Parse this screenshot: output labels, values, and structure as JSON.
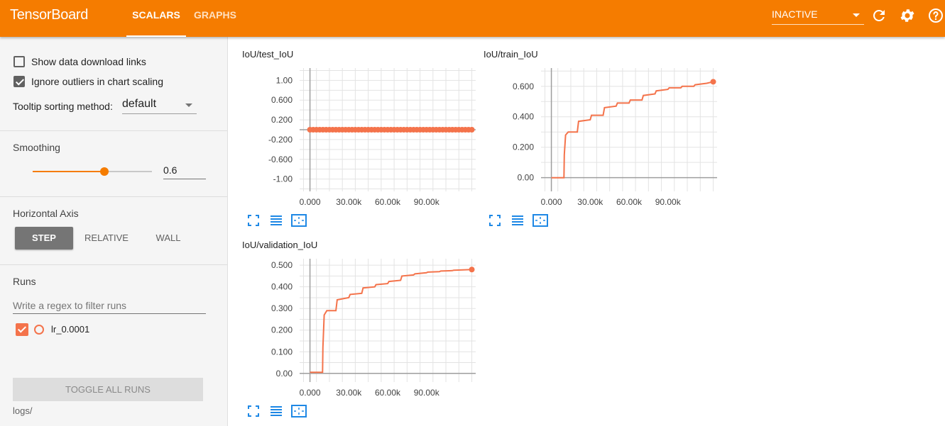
{
  "app": {
    "title": "TensorBoard"
  },
  "tabs": [
    {
      "label": "SCALARS",
      "active": true
    },
    {
      "label": "GRAPHS",
      "active": false
    }
  ],
  "status_select": {
    "value": "INACTIVE"
  },
  "icons": {
    "refresh": "refresh-icon",
    "settings": "gear-icon",
    "help": "help-icon",
    "fullscreen": "fullscreen-icon",
    "data": "list-icon",
    "fit": "fit-domain-icon"
  },
  "colors": {
    "accent": "#f57c00",
    "series": "#f4734b",
    "sidebar_bg": "#f5f5f5"
  },
  "options": {
    "show_download": {
      "label": "Show data download links",
      "checked": false
    },
    "ignore_outliers": {
      "label": "Ignore outliers in chart scaling",
      "checked": true
    },
    "tooltip_label": "Tooltip sorting method:",
    "tooltip_value": "default"
  },
  "smoothing": {
    "label": "Smoothing",
    "value": "0.6",
    "level": 0.6
  },
  "horizontal_axis": {
    "label": "Horizontal Axis",
    "buttons": [
      "STEP",
      "RELATIVE",
      "WALL"
    ],
    "selected": "STEP"
  },
  "runs": {
    "label": "Runs",
    "filter_placeholder": "Write a regex to filter runs",
    "items": [
      {
        "name": "lr_0.0001",
        "checked": true
      }
    ],
    "toggle_label": "TOGGLE ALL RUNS",
    "logdir": "logs/"
  },
  "chart_data": [
    {
      "type": "line",
      "title": "IoU/test_IoU",
      "xlabel": "",
      "ylabel": "",
      "xlim": [
        -8000,
        128000
      ],
      "ylim": [
        -1.25,
        1.25
      ],
      "xticks": [
        0,
        30000,
        60000,
        90000
      ],
      "xtick_labels": [
        "0.000",
        "30.00k",
        "60.00k",
        "90.00k"
      ],
      "yticks": [
        1.0,
        0.6,
        0.2,
        -0.2,
        -0.6,
        -1.0
      ],
      "ytick_labels": [
        "1.00",
        "0.600",
        "0.200",
        "-0.200",
        "-0.600",
        "-1.00"
      ],
      "grid": true,
      "series": [
        {
          "color": "#f4734b",
          "markers": true,
          "x": [
            0,
            2500,
            5000,
            7500,
            10000,
            12500,
            15000,
            17500,
            20000,
            22500,
            25000,
            27500,
            30000,
            32500,
            35000,
            37500,
            40000,
            42500,
            45000,
            47500,
            50000,
            52500,
            55000,
            57500,
            60000,
            62500,
            65000,
            67500,
            70000,
            72500,
            75000,
            77500,
            80000,
            82500,
            85000,
            87500,
            90000,
            92500,
            95000,
            97500,
            100000,
            102500,
            105000,
            107500,
            110000,
            112500,
            115000,
            117500,
            120000,
            122500,
            125000
          ],
          "y": [
            0,
            0,
            0,
            0,
            0,
            0,
            0,
            0,
            0,
            0,
            0,
            0,
            0,
            0,
            0,
            0,
            0,
            0,
            0,
            0,
            0,
            0,
            0,
            0,
            0,
            0,
            0,
            0,
            0,
            0,
            0,
            0,
            0,
            0,
            0,
            0,
            0,
            0,
            0,
            0,
            0,
            0,
            0,
            0,
            0,
            0,
            0,
            0,
            0,
            0,
            0
          ]
        }
      ]
    },
    {
      "type": "line",
      "title": "IoU/train_IoU",
      "xlabel": "",
      "ylabel": "",
      "xlim": [
        -8000,
        128000
      ],
      "ylim": [
        -0.09,
        0.72
      ],
      "xticks": [
        0,
        30000,
        60000,
        90000
      ],
      "xtick_labels": [
        "0.000",
        "30.00k",
        "60.00k",
        "90.00k"
      ],
      "yticks": [
        0.6,
        0.4,
        0.2,
        0.0
      ],
      "ytick_labels": [
        "0.600",
        "0.400",
        "0.200",
        "0.00"
      ],
      "grid": true,
      "series": [
        {
          "color": "#f4734b",
          "end_marker": true,
          "x": [
            0,
            9700,
            10000,
            11000,
            13000,
            15500,
            20000,
            21000,
            30000,
            31000,
            40000,
            41000,
            50000,
            51000,
            60000,
            61000,
            70000,
            71000,
            80000,
            81000,
            90000,
            91000,
            100000,
            101000,
            110000,
            111000,
            120000,
            125000
          ],
          "y": [
            0.0,
            0.0,
            0.15,
            0.28,
            0.3,
            0.3,
            0.3,
            0.37,
            0.38,
            0.41,
            0.41,
            0.46,
            0.47,
            0.49,
            0.49,
            0.51,
            0.51,
            0.54,
            0.55,
            0.57,
            0.58,
            0.59,
            0.59,
            0.6,
            0.6,
            0.61,
            0.62,
            0.63
          ]
        }
      ]
    },
    {
      "type": "line",
      "title": "IoU/validation_IoU",
      "xlabel": "",
      "ylabel": "",
      "xlim": [
        -8000,
        128000
      ],
      "ylim": [
        -0.04,
        0.53
      ],
      "xticks": [
        0,
        30000,
        60000,
        90000
      ],
      "xtick_labels": [
        "0.000",
        "30.00k",
        "60.00k",
        "90.00k"
      ],
      "yticks": [
        0.5,
        0.4,
        0.3,
        0.2,
        0.1,
        0.0
      ],
      "ytick_labels": [
        "0.500",
        "0.400",
        "0.300",
        "0.200",
        "0.100",
        "0.00"
      ],
      "grid": true,
      "series": [
        {
          "color": "#f4734b",
          "end_marker": true,
          "x": [
            0,
            9700,
            10000,
            11000,
            13000,
            15500,
            20000,
            21000,
            30000,
            31000,
            40000,
            41000,
            50000,
            51000,
            60000,
            61000,
            70000,
            71000,
            80000,
            81000,
            90000,
            91000,
            100000,
            101000,
            110000,
            111000,
            120000,
            125000
          ],
          "y": [
            0.005,
            0.005,
            0.12,
            0.27,
            0.29,
            0.29,
            0.29,
            0.34,
            0.35,
            0.365,
            0.37,
            0.395,
            0.4,
            0.41,
            0.415,
            0.425,
            0.43,
            0.45,
            0.455,
            0.46,
            0.465,
            0.468,
            0.47,
            0.473,
            0.475,
            0.477,
            0.479,
            0.48
          ]
        }
      ]
    }
  ]
}
